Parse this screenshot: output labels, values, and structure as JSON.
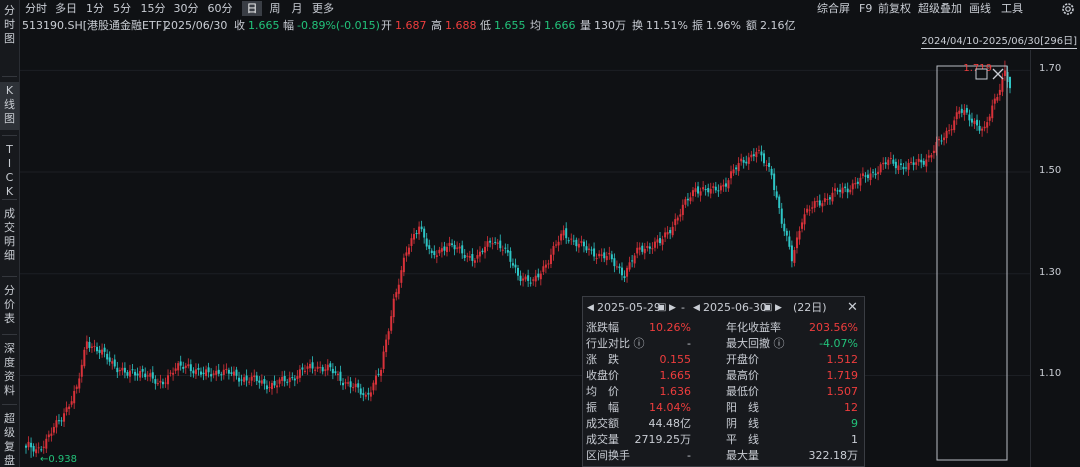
{
  "side_tabs": [
    {
      "name": "side-tab-timeshare",
      "chars": [
        "分",
        "时",
        "图"
      ]
    },
    {
      "name": "side-tab-kline",
      "chars": [
        "K",
        "线",
        "图"
      ],
      "active": true
    },
    {
      "name": "side-tab-tick",
      "chars": [
        "T",
        "I",
        "C",
        "K"
      ]
    },
    {
      "name": "side-tab-trade-detail",
      "chars": [
        "成",
        "交",
        "明",
        "细"
      ]
    },
    {
      "name": "side-tab-price-table",
      "chars": [
        "分",
        "价",
        "表"
      ]
    },
    {
      "name": "side-tab-depth",
      "chars": [
        "深",
        "度",
        "资",
        "料"
      ]
    },
    {
      "name": "side-tab-super-replay",
      "chars": [
        "超",
        "级",
        "复",
        "盘"
      ]
    }
  ],
  "toolbar": {
    "timeframes": [
      "分时",
      "多日",
      "1分",
      "5分",
      "15分",
      "30分",
      "60分",
      "日",
      "周",
      "月",
      "更多"
    ],
    "active_timeframe": "日",
    "right_items": [
      "综合屏",
      "F9",
      "前复权",
      "超级叠加",
      "画线",
      "工具"
    ]
  },
  "info": {
    "code": "513190.SH[港股通金融ETF]",
    "date": "2025/06/30",
    "close_label": "收",
    "close": "1.665",
    "change_label": "幅",
    "change": "-0.89%(-0.015)",
    "open_label": "开",
    "open": "1.687",
    "high_label": "高",
    "high": "1.688",
    "low_label": "低",
    "low": "1.655",
    "avg_label": "均",
    "avg": "1.666",
    "volume_label": "量",
    "volume": "130万",
    "turnover_label": "换",
    "turnover": "11.51%",
    "amplitude_label": "振",
    "amplitude": "1.96%",
    "amount_label": "额",
    "amount": "2.16亿"
  },
  "range_label": "2024/04/10-2025/06/30[296日]",
  "yaxis": {
    "ticks": [
      "1.70",
      "1.50",
      "1.30",
      "1.10"
    ]
  },
  "chart": {
    "low_marker": "0.938",
    "high_marker": "1.719",
    "y_min": 0.92,
    "y_max": 1.74,
    "up_color": "#d8323a",
    "down_color": "#2ec6c6"
  },
  "stats": {
    "start_date": "2025-05-29",
    "end_date": "2025-06-30",
    "days": "(22日)",
    "rows": [
      {
        "l1": "涨跌幅",
        "v1": "10.26%",
        "c1": "up",
        "l2": "年化收益率",
        "v2": "203.56%",
        "c2": "up"
      },
      {
        "l1": "行业对比 ⓘ",
        "v1": "-",
        "c1": "neu",
        "l2": "最大回撤 ⓘ",
        "v2": "-4.07%",
        "c2": "dn"
      },
      {
        "l1": "涨　跌",
        "v1": "0.155",
        "c1": "up",
        "l2": "开盘价",
        "v2": "1.512",
        "c2": "up"
      },
      {
        "l1": "收盘价",
        "v1": "1.665",
        "c1": "up",
        "l2": "最高价",
        "v2": "1.719",
        "c2": "up"
      },
      {
        "l1": "均　价",
        "v1": "1.636",
        "c1": "up",
        "l2": "最低价",
        "v2": "1.507",
        "c2": "up"
      },
      {
        "l1": "振　幅",
        "v1": "14.04%",
        "c1": "up",
        "l2": "阳　线",
        "v2": "12",
        "c2": "up"
      },
      {
        "l1": "成交额",
        "v1": "44.48亿",
        "c1": "neu",
        "l2": "阴　线",
        "v2": "9",
        "c2": "dn"
      },
      {
        "l1": "成交量",
        "v1": "2719.25万",
        "c1": "neu",
        "l2": "平　线",
        "v2": "1",
        "c2": "neu"
      },
      {
        "l1": "区间换手",
        "v1": "-",
        "c1": "neu",
        "l2": "最大量",
        "v2": "322.18万",
        "c2": "neu"
      }
    ]
  }
}
